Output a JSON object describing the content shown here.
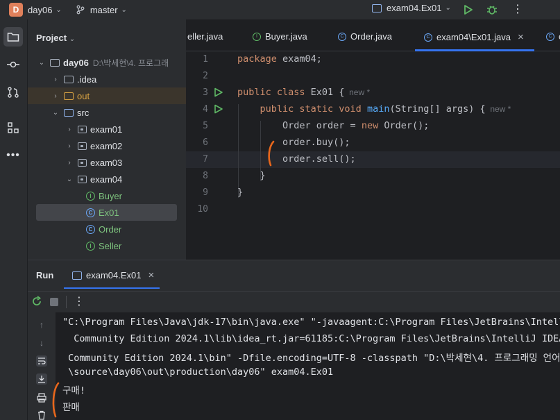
{
  "titlebar": {
    "project_badge": "D",
    "project_name": "day06",
    "branch": "master",
    "run_config": "exam04.Ex01",
    "more_icon": "more-vertical-icon"
  },
  "toolstrip": {
    "items": [
      "project-folder-icon",
      "commit-icon",
      "pull-request-icon",
      "structure-icon",
      "more-horizontal-icon"
    ]
  },
  "project_panel": {
    "title": "Project",
    "tree": [
      {
        "label": "day06",
        "extra": "D:\\박세현\\4. 프로그래",
        "type": "module",
        "expanded": true
      },
      {
        "label": ".idea",
        "type": "folder",
        "expanded": false
      },
      {
        "label": "out",
        "type": "folder-orange",
        "expanded": false
      },
      {
        "label": "src",
        "type": "folder-blue",
        "expanded": true
      },
      {
        "label": "exam01",
        "type": "package",
        "expanded": false
      },
      {
        "label": "exam02",
        "type": "package",
        "expanded": false
      },
      {
        "label": "exam03",
        "type": "package",
        "expanded": false
      },
      {
        "label": "exam04",
        "type": "package",
        "expanded": true
      },
      {
        "label": "Buyer",
        "type": "interface"
      },
      {
        "label": "Ex01",
        "type": "class-main",
        "selected": true
      },
      {
        "label": "Order",
        "type": "class"
      },
      {
        "label": "Seller",
        "type": "interface"
      }
    ]
  },
  "editor": {
    "tabs": [
      {
        "label": "eller.java",
        "icon": "interface",
        "active": false
      },
      {
        "label": "Buyer.java",
        "icon": "interface",
        "active": false
      },
      {
        "label": "Order.java",
        "icon": "class",
        "active": false
      },
      {
        "label": "exam04\\Ex01.java",
        "icon": "class-main",
        "active": true,
        "close": "×"
      },
      {
        "label": "e",
        "icon": "class",
        "active": false
      }
    ],
    "line_numbers": [
      "1",
      "2",
      "3",
      "4",
      "5",
      "6",
      "7",
      "8",
      "9",
      "10"
    ],
    "lines": [
      {
        "n": 1,
        "segs": [
          [
            "kw",
            "package"
          ],
          [
            "t",
            " exam04;"
          ]
        ]
      },
      {
        "n": 2,
        "segs": []
      },
      {
        "n": 3,
        "segs": [
          [
            "kw",
            "public class"
          ],
          [
            "t",
            " Ex01 {"
          ]
        ],
        "hint": "new *"
      },
      {
        "n": 4,
        "segs": [
          [
            "t",
            "    "
          ],
          [
            "kw",
            "public static void"
          ],
          [
            "t",
            " "
          ],
          [
            "fn",
            "main"
          ],
          [
            "t",
            "(String[] args) {"
          ]
        ],
        "hint": "new *"
      },
      {
        "n": 5,
        "segs": [
          [
            "t",
            "        Order order = "
          ],
          [
            "kw",
            "new"
          ],
          [
            "t",
            " Order();"
          ]
        ]
      },
      {
        "n": 6,
        "segs": [
          [
            "t",
            "        order.buy();"
          ]
        ]
      },
      {
        "n": 7,
        "segs": [
          [
            "t",
            "        order.sell();"
          ]
        ]
      },
      {
        "n": 8,
        "segs": [
          [
            "t",
            "    }"
          ]
        ]
      },
      {
        "n": 9,
        "segs": [
          [
            "t",
            "}"
          ]
        ]
      },
      {
        "n": 10,
        "segs": []
      }
    ]
  },
  "run_panel": {
    "title": "Run",
    "tab": "exam04.Ex01",
    "tab_close": "×",
    "console": [
      "\"C:\\Program Files\\Java\\jdk-17\\bin\\java.exe\" \"-javaagent:C:\\Program Files\\JetBrains\\Intelli",
      "  Community Edition 2024.1\\lib\\idea_rt.jar=61185:C:\\Program Files\\JetBrains\\IntelliJ IDEA",
      " Community Edition 2024.1\\bin\" -Dfile.encoding=UTF-8 -classpath \"D:\\박세현\\4. 프로그래밍 언어",
      " \\source\\day06\\out\\production\\day06\" exam04.Ex01",
      "구매!",
      "판매"
    ]
  },
  "colors": {
    "accent": "#3574f0",
    "keyword": "#cf8e6d",
    "function": "#56a8f5",
    "run_green": "#5fb865",
    "annotation": "#e8671c"
  }
}
